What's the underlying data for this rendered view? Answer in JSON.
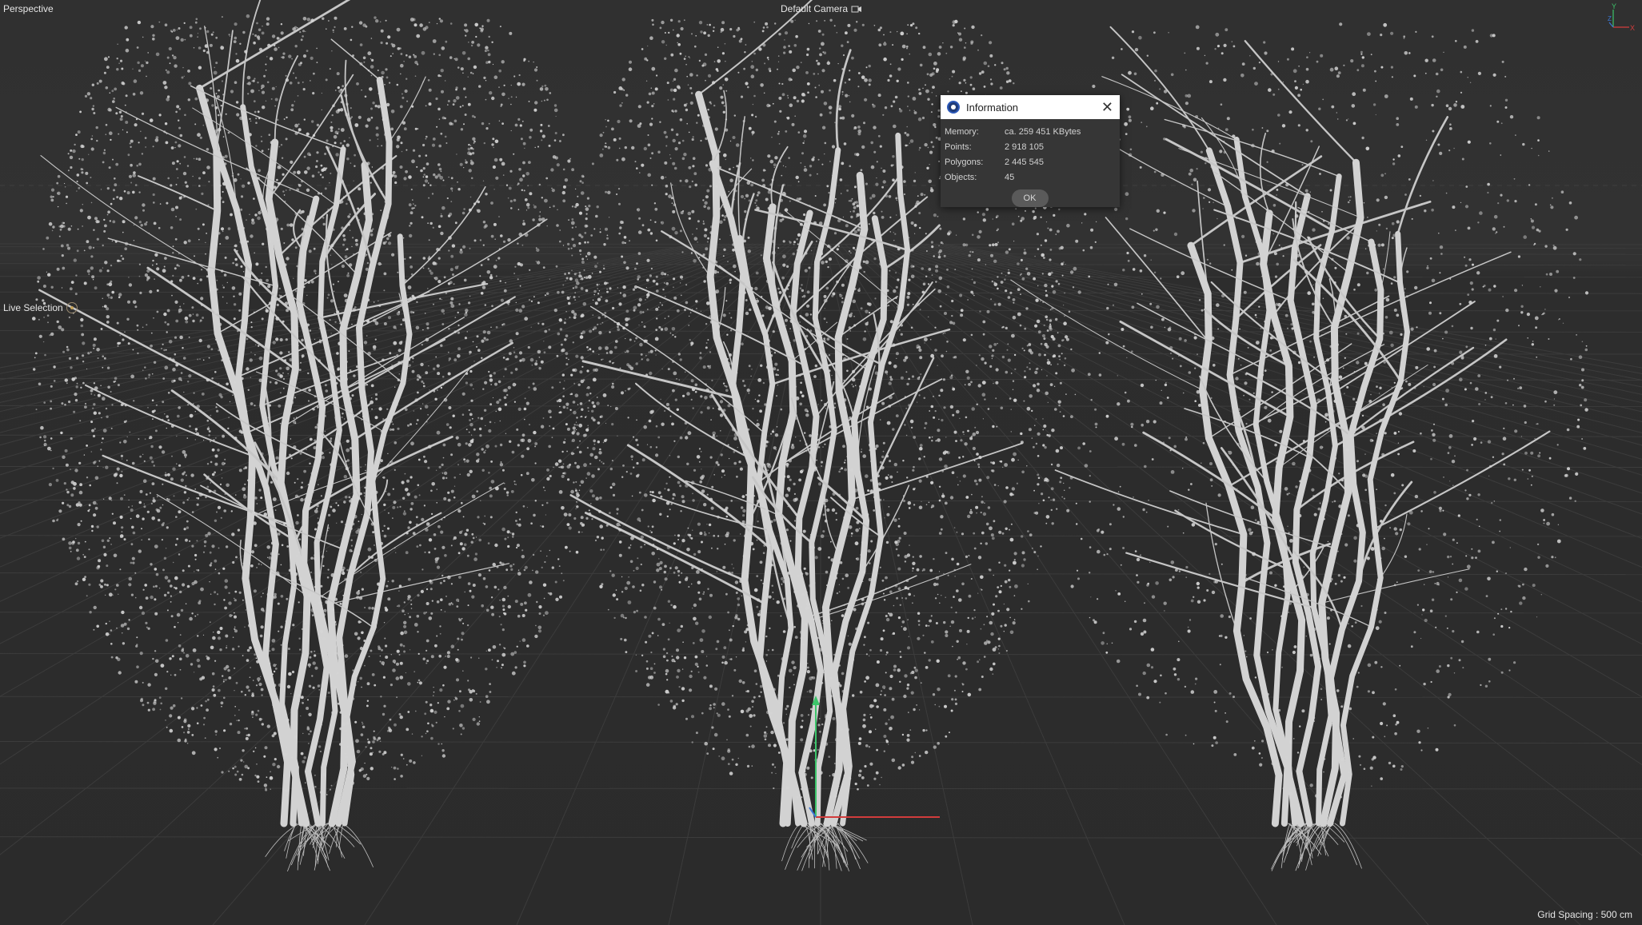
{
  "viewport": {
    "view_name": "Perspective",
    "camera_label": "Default Camera",
    "camera_icon": "camera-icon",
    "tool_label": "Live Selection",
    "tool_icon": "live-selection-icon",
    "grid_spacing": "Grid Spacing : 500 cm",
    "axis": {
      "y": "Y",
      "z": "Z",
      "x": "X"
    }
  },
  "colors": {
    "background": "#2f2f2f",
    "axis_x": "#d23c3c",
    "axis_y": "#3cc46a",
    "axis_z": "#3a78d8",
    "foliage": "#d4d4d4"
  },
  "dialog": {
    "title": "Information",
    "close_icon": "close-icon",
    "rows": [
      {
        "key": "Memory:",
        "value": "ca. 259 451 KBytes"
      },
      {
        "key": "Points:",
        "value": "2 918 105"
      },
      {
        "key": "Polygons:",
        "value": "2 445 545"
      },
      {
        "key": "Objects:",
        "value": "45"
      }
    ],
    "ok_label": "OK"
  }
}
